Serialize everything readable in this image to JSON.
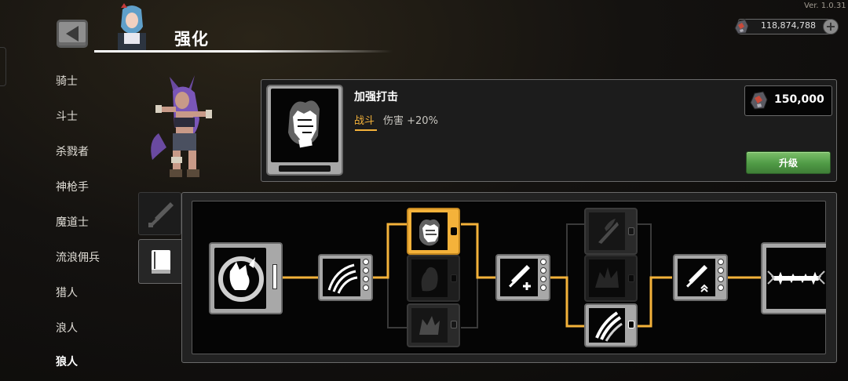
{
  "version": "Ver. 1.0.31",
  "header": {
    "title": "强化"
  },
  "currency": {
    "amount": "118,874,788",
    "icon": "ore-icon"
  },
  "class_list": [
    "骑士",
    "斗士",
    "杀戮者",
    "神枪手",
    "魔道士",
    "流浪佣兵",
    "猎人",
    "浪人",
    "狼人"
  ],
  "selected_class": "狼人",
  "skill_detail": {
    "name": "加强打击",
    "category": "战斗",
    "effect": "伤害 +20%",
    "cost": "150,000",
    "upgrade_label": "升级"
  },
  "tree_tabs": [
    {
      "name": "sword",
      "icon": "sword-icon",
      "active": false
    },
    {
      "name": "book",
      "icon": "book-icon",
      "active": true
    }
  ],
  "colors": {
    "accent": "#f4b23a",
    "button_green": "#4f9a45",
    "highlight_node": "#f4b23a"
  },
  "tree_nodes": [
    {
      "id": "root",
      "icon": "wolf-moon-icon",
      "state": "unlocked"
    },
    {
      "id": "n1",
      "icon": "claw-slash-icon",
      "state": "unlocked"
    },
    {
      "id": "n2a",
      "icon": "fist-icon",
      "state": "selected"
    },
    {
      "id": "n2b",
      "icon": "flame-fist-icon",
      "state": "locked"
    },
    {
      "id": "n2c",
      "icon": "wolf-spirit-icon",
      "state": "locked"
    },
    {
      "id": "n3",
      "icon": "sword-plus-icon",
      "state": "unlocked"
    },
    {
      "id": "n4a",
      "icon": "sword-wing-icon",
      "state": "locked"
    },
    {
      "id": "n4b",
      "icon": "beast-shadow-icon",
      "state": "locked"
    },
    {
      "id": "n4c",
      "icon": "triple-claw-icon",
      "state": "unlocked"
    },
    {
      "id": "n5",
      "icon": "sword-up-icon",
      "state": "unlocked"
    },
    {
      "id": "n6",
      "icon": "fangs-icon",
      "state": "unlocked"
    }
  ]
}
